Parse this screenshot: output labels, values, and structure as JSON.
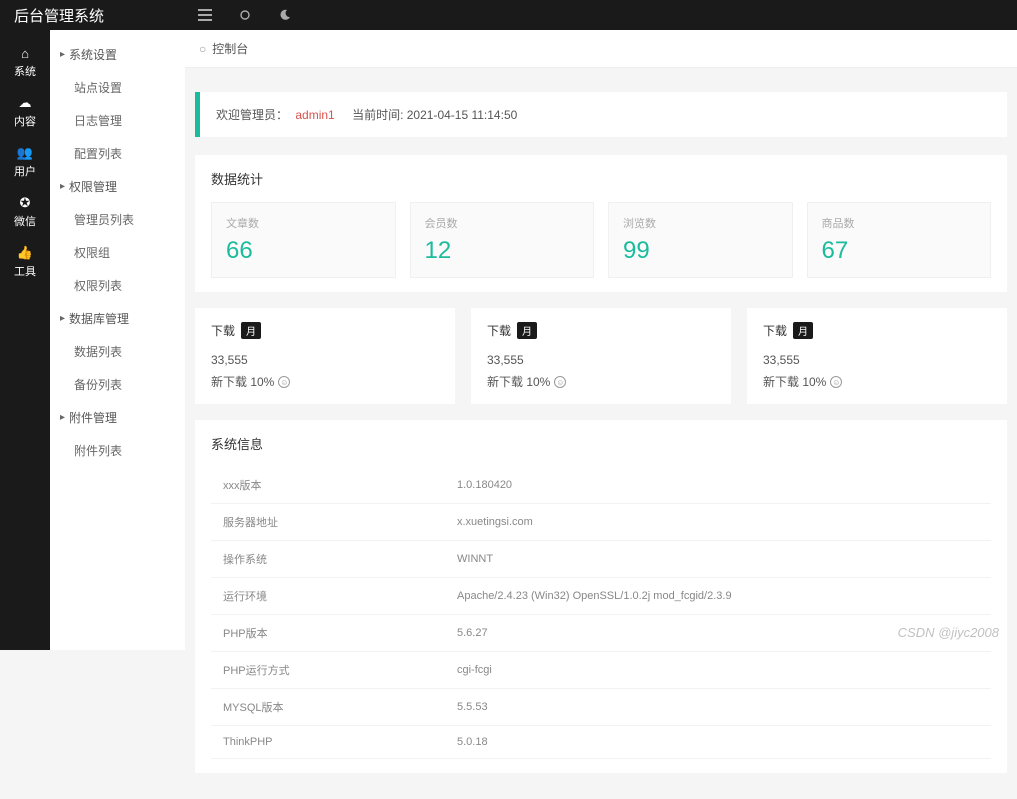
{
  "brand": "后台管理系统",
  "iconNav": [
    {
      "icon": "home",
      "label": "系统"
    },
    {
      "icon": "cloud",
      "label": "内容"
    },
    {
      "icon": "user",
      "label": "用户"
    },
    {
      "icon": "wechat",
      "label": "微信"
    },
    {
      "icon": "thumb",
      "label": "工具"
    }
  ],
  "sidebar": {
    "groups": [
      {
        "label": "系统设置",
        "items": [
          "站点设置",
          "日志管理",
          "配置列表"
        ]
      },
      {
        "label": "权限管理",
        "items": [
          "管理员列表",
          "权限组",
          "权限列表"
        ]
      },
      {
        "label": "数据库管理",
        "items": [
          "数据列表",
          "备份列表"
        ]
      },
      {
        "label": "附件管理",
        "items": [
          "附件列表"
        ]
      }
    ]
  },
  "breadcrumb": {
    "label": "控制台"
  },
  "welcome": {
    "prefix": "欢迎管理员：",
    "admin": "admin1",
    "timePrefix": "当前时间:",
    "time": "2021-04-15 11:14:50"
  },
  "stats": {
    "title": "数据统计",
    "items": [
      {
        "label": "文章数",
        "value": "66"
      },
      {
        "label": "会员数",
        "value": "12"
      },
      {
        "label": "浏览数",
        "value": "99"
      },
      {
        "label": "商品数",
        "value": "67"
      }
    ]
  },
  "downloads": {
    "cards": [
      {
        "title": "下载",
        "badge": "月",
        "num": "33,555",
        "growth": "新下载 10%"
      },
      {
        "title": "下载",
        "badge": "月",
        "num": "33,555",
        "growth": "新下载 10%"
      },
      {
        "title": "下载",
        "badge": "月",
        "num": "33,555",
        "growth": "新下载 10%"
      }
    ]
  },
  "sysinfo": {
    "title": "系统信息",
    "rows": [
      {
        "k": "xxx版本",
        "v": "1.0.180420"
      },
      {
        "k": "服务器地址",
        "v": "x.xuetingsi.com"
      },
      {
        "k": "操作系统",
        "v": "WINNT"
      },
      {
        "k": "运行环境",
        "v": "Apache/2.4.23 (Win32) OpenSSL/1.0.2j mod_fcgid/2.3.9"
      },
      {
        "k": "PHP版本",
        "v": "5.6.27"
      },
      {
        "k": "PHP运行方式",
        "v": "cgi-fcgi"
      },
      {
        "k": "MYSQL版本",
        "v": "5.5.53"
      },
      {
        "k": "ThinkPHP",
        "v": "5.0.18"
      }
    ]
  },
  "watermark": "CSDN @jiyc2008"
}
